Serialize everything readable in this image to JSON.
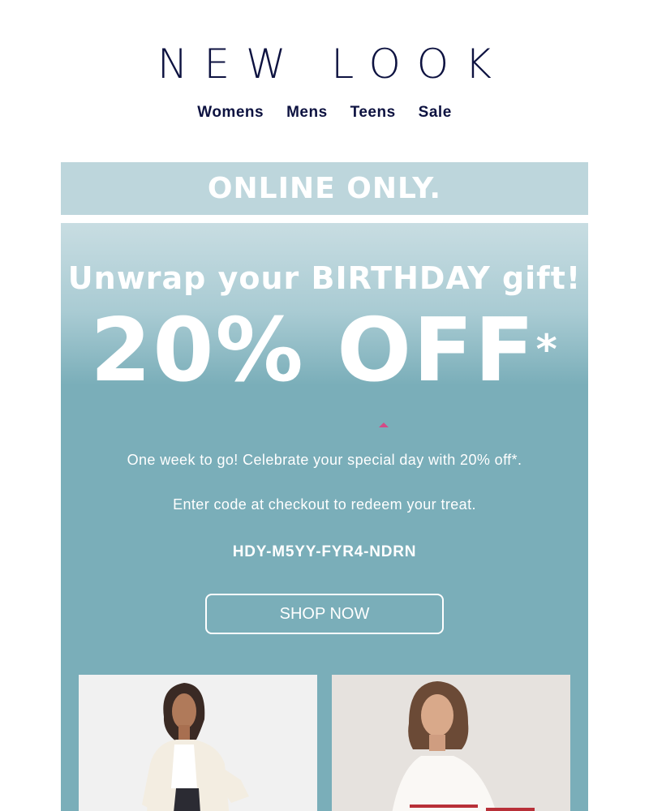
{
  "brand": {
    "logo_text": "NEW LOOK",
    "color": "#0d1240"
  },
  "nav": [
    {
      "label": "Womens"
    },
    {
      "label": "Mens"
    },
    {
      "label": "Teens"
    },
    {
      "label": "Sale"
    }
  ],
  "banner": {
    "text": "ONLINE ONLY.",
    "background": "#bdd6dc"
  },
  "hero": {
    "headline": "Unwrap your BIRTHDAY gift!",
    "offer": "20% OFF",
    "offer_mark": "*",
    "line1": "One week to go! Celebrate your special day with 20% off*.",
    "line2": "Enter code at checkout to redeem your treat.",
    "code": "HDY-M5YY-FYR4-NDRN",
    "cta": "SHOP NOW",
    "background": "#7aaeb9"
  },
  "products": [
    {
      "name": "product-image-cream-cardigan"
    },
    {
      "name": "product-image-striped-jumper"
    }
  ]
}
